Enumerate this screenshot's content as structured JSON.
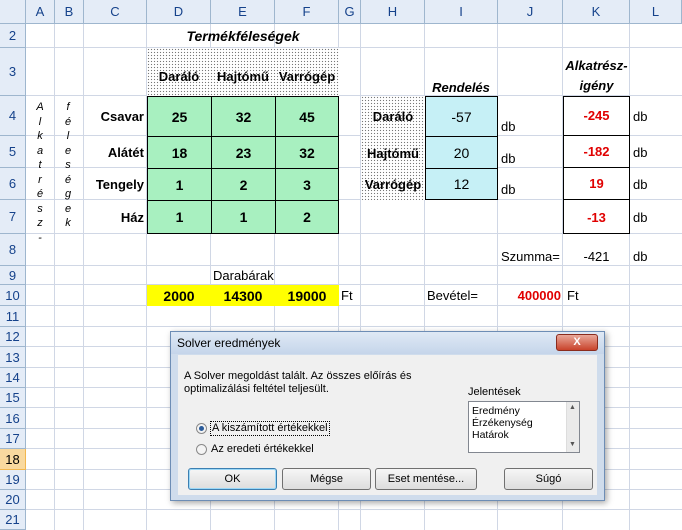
{
  "columns": [
    "A",
    "B",
    "C",
    "D",
    "E",
    "F",
    "G",
    "H",
    "I",
    "J",
    "K",
    "L"
  ],
  "rows": [
    "2",
    "3",
    "4",
    "5",
    "6",
    "7",
    "8",
    "9",
    "10",
    "11",
    "12",
    "13",
    "14",
    "15",
    "16",
    "17",
    "18",
    "19",
    "20",
    "21"
  ],
  "selected_row": "18",
  "title": "Termékféleségek",
  "product_headers": [
    "Daráló",
    "Hajtómű",
    "Varrógép"
  ],
  "parts": [
    "Csavar",
    "Alátét",
    "Tengely",
    "Ház"
  ],
  "matrix": [
    [
      "25",
      "32",
      "45"
    ],
    [
      "18",
      "23",
      "32"
    ],
    [
      "1",
      "2",
      "3"
    ],
    [
      "1",
      "1",
      "2"
    ]
  ],
  "vertical_a": "Alkatrész-",
  "vertical_b": "féleségek",
  "order_header": "Rendelés",
  "orders": [
    {
      "name": "Daráló",
      "value": "-57"
    },
    {
      "name": "Hajtómű",
      "value": "20"
    },
    {
      "name": "Varrógép",
      "value": "12"
    }
  ],
  "unit_db": "db",
  "demand_header_1": "Alkatrész-",
  "demand_header_2": "igény",
  "demand": [
    "-245",
    "-182",
    "19",
    "-13"
  ],
  "summa_label": "Szumma=",
  "summa_value": "-421",
  "prices_label": "Darabárak",
  "prices": [
    "2000",
    "14300",
    "19000"
  ],
  "unit_ft": "Ft",
  "revenue_label": "Bevétel=",
  "revenue_value": "400000",
  "colors": {
    "green": "#a8f0c0",
    "cyan": "#c6f0f6",
    "yellow": "#ffff00",
    "red": "#e00000"
  },
  "dialog": {
    "title": "Solver eredmények",
    "close": "X",
    "message_1": "A Solver megoldást talált. Az összes előírás és",
    "message_2": "optimalizálási feltétel teljesült.",
    "reports_label": "Jelentések",
    "reports": [
      "Eredmény",
      "Érzékenység",
      "Határok"
    ],
    "radio_keep": "A kiszámított értékekkel",
    "radio_restore": "Az eredeti értékekkel",
    "ok": "OK",
    "cancel": "Mégse",
    "save": "Eset mentése...",
    "help": "Súgó"
  }
}
